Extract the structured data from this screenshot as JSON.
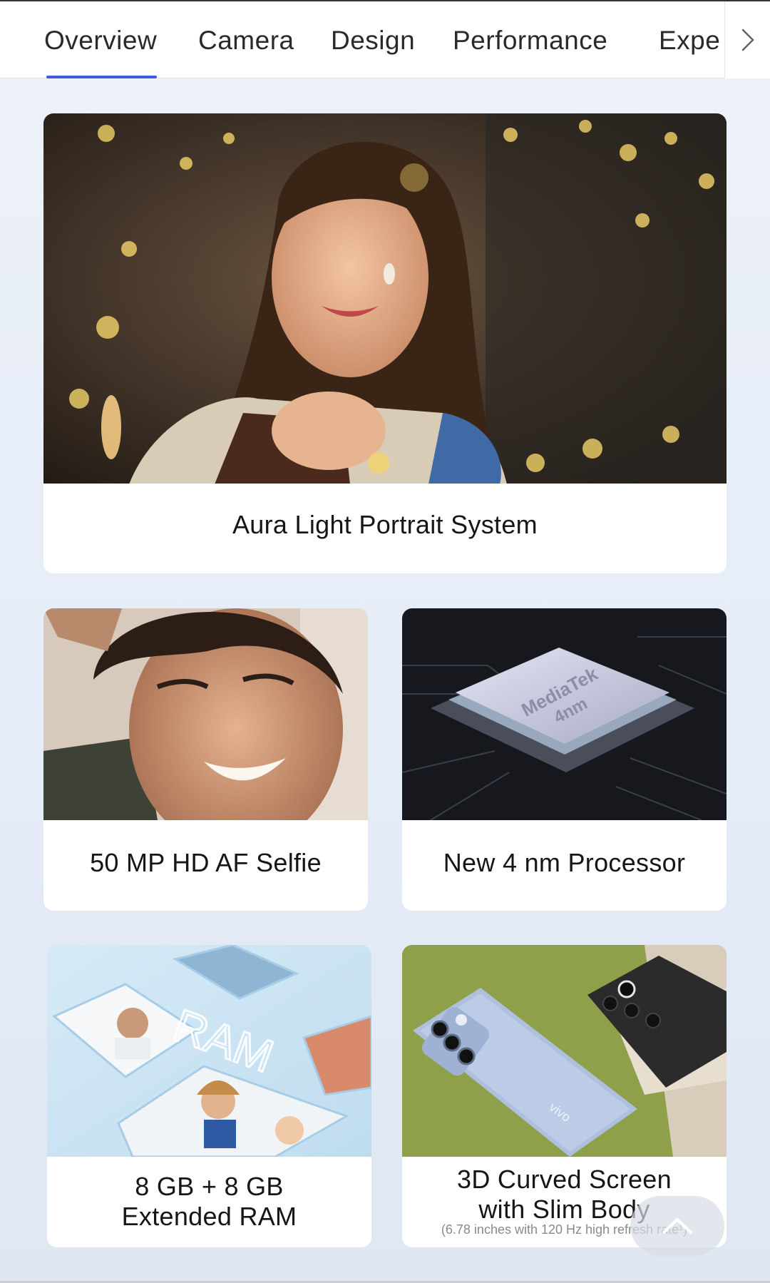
{
  "tabs": [
    {
      "label": "Overview",
      "active": true
    },
    {
      "label": "Camera",
      "active": false
    },
    {
      "label": "Design",
      "active": false
    },
    {
      "label": "Performance",
      "active": false
    },
    {
      "label": "Expe",
      "active": false
    }
  ],
  "tab_arrow_icon": "chevron-right-icon",
  "accent_color": "#3d5ae0",
  "cards": {
    "aura": {
      "caption": "Aura Light Portrait System"
    },
    "selfie": {
      "caption": "50 MP HD AF Selfie"
    },
    "processor": {
      "caption": "New 4 nm Processor",
      "chip_line1": "MediaTek",
      "chip_line2": "4nm"
    },
    "ram": {
      "caption_line1": "8 GB + 8 GB",
      "caption_line2": "Extended RAM",
      "graphic_text": "RAM"
    },
    "screen": {
      "caption_line1": "3D Curved Screen",
      "caption_line2": "with Slim Body",
      "note": "(6.78 inches with 120 Hz high refresh rate¹)",
      "phone_brand": "vivo"
    }
  },
  "scroll_top_icon": "chevron-up-icon"
}
